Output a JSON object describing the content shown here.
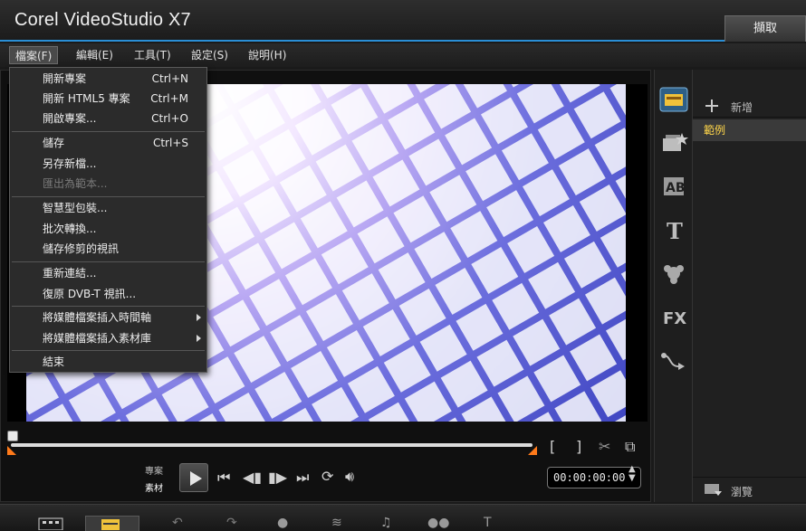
{
  "app": {
    "title": "Corel VideoStudio X7",
    "capture_tab": "擷取"
  },
  "menubar": {
    "items": [
      {
        "label": "檔案(F)",
        "active": true
      },
      {
        "label": "編輯(E)"
      },
      {
        "label": "工具(T)"
      },
      {
        "label": "設定(S)"
      },
      {
        "label": "說明(H)"
      }
    ]
  },
  "file_menu": {
    "items": [
      {
        "label": "開新專案",
        "shortcut": "Ctrl+N"
      },
      {
        "label": "開新 HTML5 專案",
        "shortcut": "Ctrl+M"
      },
      {
        "label": "開啟專案...",
        "shortcut": "Ctrl+O"
      },
      {
        "label": "儲存",
        "shortcut": "Ctrl+S"
      },
      {
        "label": "另存新檔..."
      },
      {
        "label": "匯出為範本...",
        "disabled": true
      },
      {
        "label": "智慧型包裝..."
      },
      {
        "label": "批次轉換..."
      },
      {
        "label": "儲存修剪的視訊"
      },
      {
        "label": "重新連結..."
      },
      {
        "label": "復原 DVB-T 視訊..."
      },
      {
        "label": "將媒體檔案插入時間軸",
        "submenu": true
      },
      {
        "label": "將媒體檔案插入素材庫",
        "submenu": true
      },
      {
        "label": "結束"
      }
    ]
  },
  "library": {
    "add_label": "新增",
    "sample_label": "範例",
    "browse_label": "瀏覽"
  },
  "playback": {
    "project_label": "專案",
    "clip_label": "素材",
    "timecode": "00:00:00:00"
  },
  "colors": {
    "accent": "#2a8fd6",
    "trim": "#ff7a1a",
    "sample_highlight": "#ffd64a"
  },
  "icons": {
    "side_strip": [
      "media-library-icon",
      "instant-project-icon",
      "transition-icon",
      "title-icon",
      "graphics-icon",
      "filter-icon",
      "path-icon"
    ]
  }
}
